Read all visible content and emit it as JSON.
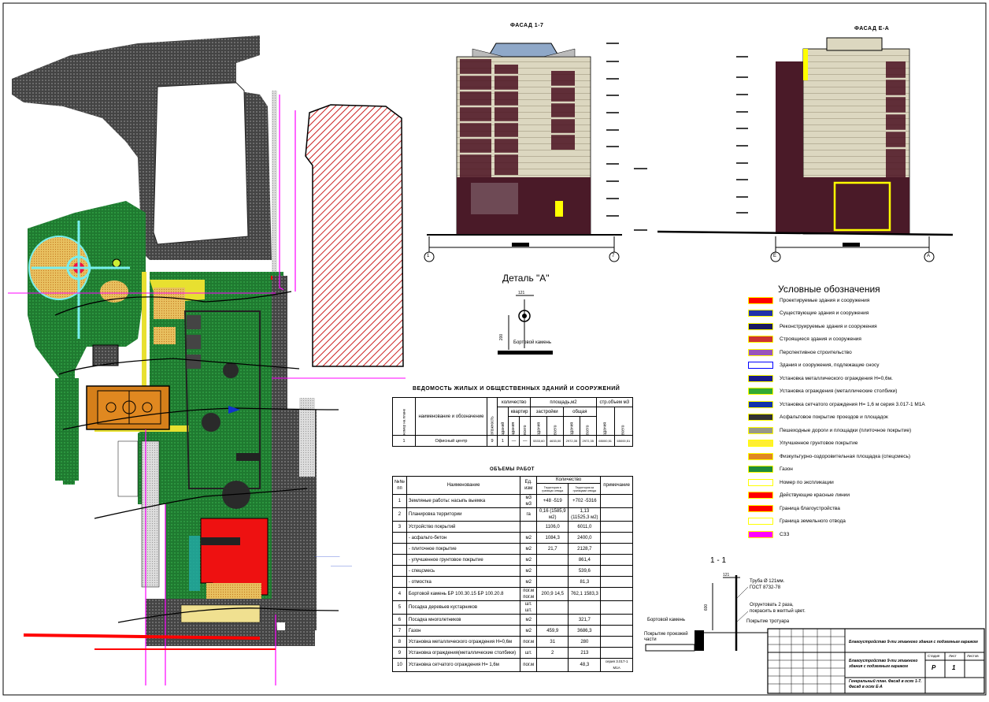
{
  "facades": {
    "left_title": "ФАСАД 1-7",
    "right_title": "ФАСАД Е-А",
    "left_axes": [
      "1",
      "7"
    ],
    "right_axes": [
      "Е",
      "А"
    ]
  },
  "detail": {
    "title": "Деталь \"А\"",
    "dim": "121",
    "vert_dim": "200",
    "label": "Бортовой камень"
  },
  "legend": {
    "title": "Условные обозначения",
    "items": [
      {
        "label": "Проектируемые здания и сооружения",
        "color": "#ff0000",
        "border": "#ffff00"
      },
      {
        "label": "Существующие здания и сооружения",
        "color": "#2233aa",
        "border": "#ffff00"
      },
      {
        "label": "Реконструируемые здания и сооружения",
        "color": "#1a1a60",
        "border": "#ffff00"
      },
      {
        "label": "Строящиеся здания и сооружения",
        "color": "#cc3333",
        "border": "#ffff00"
      },
      {
        "label": "Перспективное строительство",
        "color": "#9955bb",
        "border": "#ffff00"
      },
      {
        "label": "Здания и сооружения, подлежащие сносу",
        "color": "#ffffff",
        "border": "#0000ff"
      },
      {
        "label": "Установка металлического ограждения Н=0,6м.",
        "color": "#1a1a8a",
        "border": "#ffff00"
      },
      {
        "label": "Установка ограждения (металлические столбики)",
        "color": "#33aa33",
        "border": "#ffff00"
      },
      {
        "label": "Установка сетчатого ограждения Н= 1,6 м серия 3.017-1 М1А",
        "color": "#1133aa",
        "border": "#ffff00"
      },
      {
        "label": "Асфальтовое покрытие проездов и площадок",
        "color": "#333333",
        "border": "#ffff00"
      },
      {
        "label": "Пешеходные дороги и площадки (плиточное покрытие)",
        "color": "#999988",
        "border": "#ffff00"
      },
      {
        "label": "Улучшенное грунтовое покрытие",
        "color": "#ffee33",
        "border": "#ffff00"
      },
      {
        "label": "Физкультурно-оздоровительная площадка (спецсмесь)",
        "color": "#e08820",
        "border": "#ffff00"
      },
      {
        "label": "Газон",
        "color": "#1f8a3a",
        "border": "#ffff00"
      },
      {
        "label": "Номер по экспликации",
        "color": "#ffffff",
        "border": "#ffff00"
      },
      {
        "label": "Действующие красные линии",
        "color": "#ff0000",
        "border": "#ffff00"
      },
      {
        "label": "Граница благоустройства",
        "color": "#ff0000",
        "border": "#ffff00"
      },
      {
        "label": "Граница земельного отвода",
        "color": "#ffffff",
        "border": "#ffff00"
      },
      {
        "label": "СЗЗ",
        "color": "#ff00ff",
        "border": "#ffff00"
      }
    ]
  },
  "buildings_table": {
    "title": "ВЕДОМОСТЬ ЖИЛЫХ И ОБЩЕСТВЕННЫХ ЗДАНИЙ И СООРУЖЕНИЙ",
    "h_num": "номер на плане",
    "h_name": "наименование и обозначение",
    "h_floors": "этажность",
    "h_qty": "количество",
    "h_area": "площадь,м2",
    "h_vol": "стр.объем м3",
    "h_bld": "зданий",
    "h_flats": "квартир",
    "h_built": "застройки",
    "h_total": "общая",
    "h_one": "здания",
    "h_all": "всего",
    "row": [
      "1",
      "Офисный центр",
      "9",
      "1",
      "—",
      "—",
      "5333,60",
      "4633,00",
      "2972,35",
      "2972,35",
      "65000,51",
      "65000,51"
    ]
  },
  "works_table": {
    "title": "ОБЪЕМЫ РАБОТ",
    "h_num": "№№ пп",
    "h_name": "Наименование",
    "h_unit": "Ед. изм",
    "h_qty": "Количество",
    "h_sub1": "Территория в границах отвода",
    "h_sub2": "Территория за границами отвода",
    "h_note": "примечание",
    "rows": [
      {
        "n": "1",
        "name": "Земляные работы: насыпь выемка",
        "unit": "м3 м3",
        "a": "+48 -519",
        "b": "+702 -5316",
        "note": ""
      },
      {
        "n": "2",
        "name": "Планировка территории",
        "unit": "га",
        "a": "0,16 (1585,9 м2)",
        "b": "1,13 (11525,3 м2)",
        "note": ""
      },
      {
        "n": "3",
        "name": "Устройство покрытий",
        "unit": "",
        "a": "1106,0",
        "b": "6011,0",
        "note": ""
      },
      {
        "n": "",
        "name": "- асфальто-бетон",
        "unit": "м2",
        "a": "1084,3",
        "b": "2400,0",
        "note": ""
      },
      {
        "n": "",
        "name": "- плиточное покрытие",
        "unit": "м2",
        "a": "21,7",
        "b": "2128,7",
        "note": ""
      },
      {
        "n": "",
        "name": "- улучшенное грунтовое покрытие",
        "unit": "м2",
        "a": "",
        "b": "861,4",
        "note": ""
      },
      {
        "n": "",
        "name": "- спецсмесь",
        "unit": "м2",
        "a": "",
        "b": "539,6",
        "note": ""
      },
      {
        "n": "",
        "name": "- отмостка",
        "unit": "м2",
        "a": "",
        "b": "81,3",
        "note": ""
      },
      {
        "n": "4",
        "name": "Бортовой камень БР 100.30.15 БР 100.20.8",
        "unit": "пог.м пог.м",
        "a": "200,9 14,5",
        "b": "762,1 1583,3",
        "note": ""
      },
      {
        "n": "5",
        "name": "Посадка деревьев кустарников",
        "unit": "шт. шт.",
        "a": "",
        "b": "",
        "note": ""
      },
      {
        "n": "6",
        "name": "Посадка многолетников",
        "unit": "м2",
        "a": "",
        "b": "321,7",
        "note": ""
      },
      {
        "n": "7",
        "name": "Газон",
        "unit": "м2",
        "a": "459,9",
        "b": "3686,3",
        "note": ""
      },
      {
        "n": "8",
        "name": "Установка металлического ограждения Н=0,6м",
        "unit": "пог.м",
        "a": "31",
        "b": "280",
        "note": ""
      },
      {
        "n": "9",
        "name": "Установка ограждения(металлические столбики)",
        "unit": "шт.",
        "a": "2",
        "b": "213",
        "note": ""
      },
      {
        "n": "10",
        "name": "Установка сетчатого ограждения Н= 1,6м",
        "unit": "пог.м",
        "a": "",
        "b": "48,3",
        "note": "серия 3.017-1 М1А"
      }
    ]
  },
  "section": {
    "title": "1 - 1",
    "dim": "121",
    "vert": "600",
    "pipe": "Труба Ø 121мм. ГОСТ 8732-78",
    "prime": "Огрунтовать 2 раза, покрасить в желтый цвет.",
    "walk": "Покрытие тротуара",
    "curb": "Бортовой камень",
    "road": "Покрытие проезжей части"
  },
  "stamp": {
    "project": "Благоустройство 9-ти этажного здания с подземным гаражом",
    "sheet_title": "Благоустройство 9-ти этажного здания с подземным гаражом",
    "drawing": "Генеральный план. Фасад в осях 1-7. Фасад в осях Е-А",
    "stage_h": "Стадия",
    "sheet_h": "Лист",
    "sheets_h": "Листов",
    "stage": "Р",
    "sheet": "1"
  }
}
